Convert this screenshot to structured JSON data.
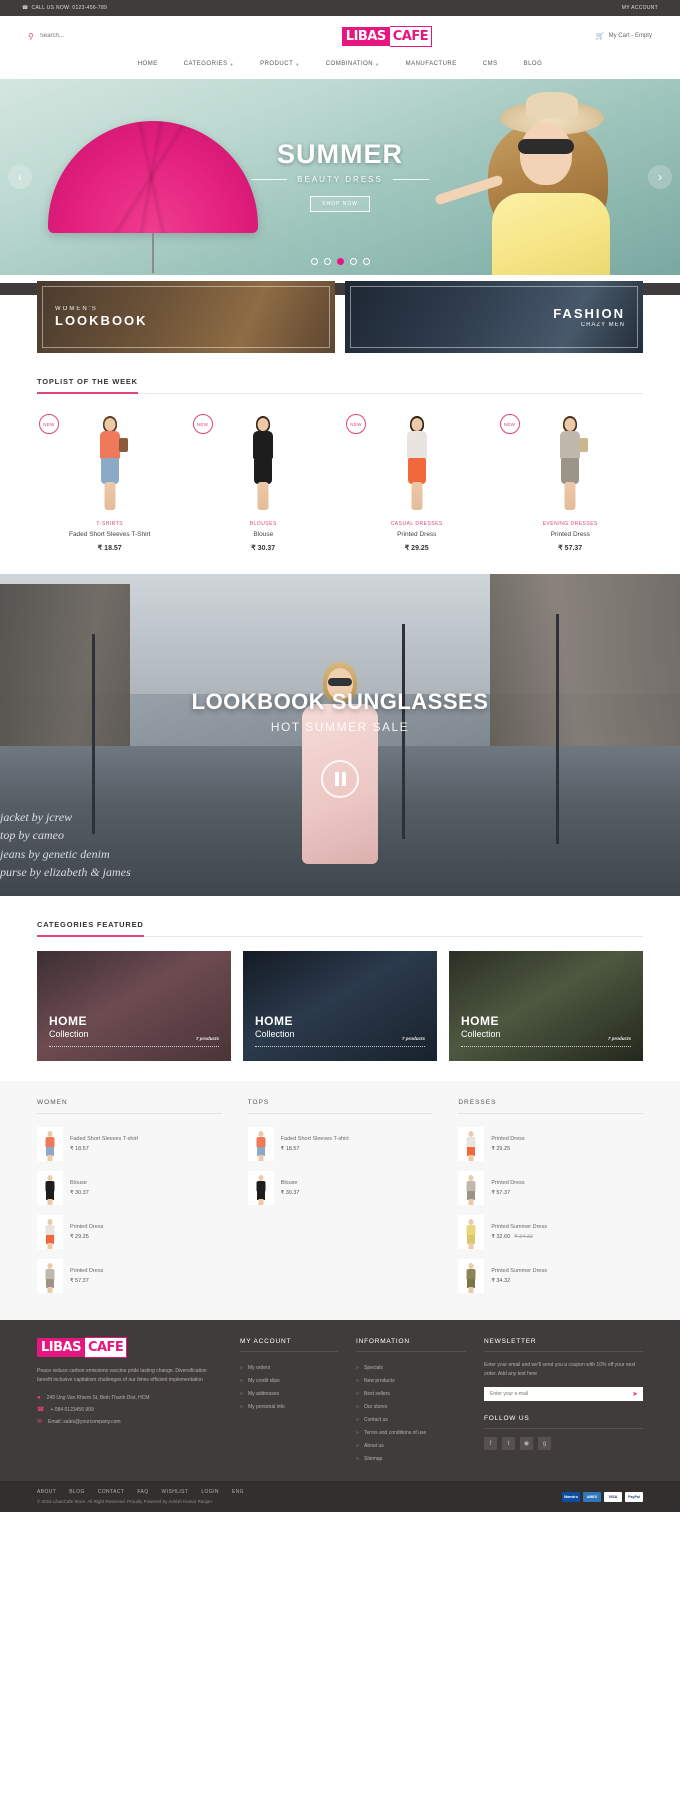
{
  "topbar": {
    "phone_icon": "phone-icon",
    "phone_label": "CALL US NOW: 0123-456-789",
    "account_label": "MY ACCOUNT"
  },
  "header": {
    "search_icon": "search-icon",
    "search_placeholder": "Search...",
    "search_value": "",
    "logo_left": "LIBAS",
    "logo_right": "CAFE",
    "cart_icon": "cart-icon",
    "cart_label": "My Cart - Empty"
  },
  "nav": {
    "items": [
      {
        "label": "HOME",
        "has_caret": false
      },
      {
        "label": "CATEGORIES",
        "has_caret": true
      },
      {
        "label": "PRODUCT",
        "has_caret": true
      },
      {
        "label": "COMBINATION",
        "has_caret": true
      },
      {
        "label": "MANUFACTURE",
        "has_caret": false
      },
      {
        "label": "CMS",
        "has_caret": false
      },
      {
        "label": "BLOG",
        "has_caret": false
      }
    ]
  },
  "hero": {
    "title": "SUMMER",
    "subtitle": "BEAUTY DRESS",
    "button_label": "SHOP NOW",
    "prev_icon": "chevron-left-icon",
    "next_icon": "chevron-right-icon",
    "dots": 5,
    "active_dot": 3
  },
  "banners": [
    {
      "sub": "WOMEN'S",
      "title": "LOOKBOOK",
      "sub2": ""
    },
    {
      "sub": "",
      "title": "FASHION",
      "sub2": "CRAZY MEN"
    }
  ],
  "toplist": {
    "title": "TOPLIST OF THE WEEK",
    "badge_label": "NEW",
    "products": [
      {
        "category": "T-SHIRTS",
        "name": "Faded Short Sleeves T-Shirt",
        "price": "₹ 18.57",
        "hair": "#5b3a22",
        "top": "#f0795a",
        "bottom": "#8ca9c8",
        "legs": "#eec9a8"
      },
      {
        "category": "BLOUSES",
        "name": "Blouse",
        "price": "₹ 30.37",
        "hair": "#3a2616",
        "top": "#1d1d1d",
        "bottom": "#1d1d1d",
        "legs": "#eec9a8"
      },
      {
        "category": "CASUAL DRESSES",
        "name": "Printed Dress",
        "price": "₹ 29.25",
        "hair": "#2e1f12",
        "top": "#e8e4df",
        "bottom": "#f2683c",
        "legs": "#eec9a8"
      },
      {
        "category": "EVENING DRESSES",
        "name": "Printed Dress",
        "price": "₹ 57.37",
        "hair": "#4a2f1a",
        "top": "#bfb9ad",
        "bottom": "#9c9487",
        "legs": "#eec9a8"
      }
    ]
  },
  "video": {
    "title": "LOOKBOOK SUNGLASSES",
    "subtitle": "HOT SUMMER SALE",
    "play_icon": "pause-icon",
    "caption": "jacket by jcrew\ntop by cameo\njeans by genetic denim\npurse by elizabeth & james"
  },
  "categories_featured": {
    "title": "CATEGORIES FEATURED",
    "items": [
      {
        "title": "HOME",
        "subtitle": "Collection",
        "count": "7 products"
      },
      {
        "title": "HOME",
        "subtitle": "Collection",
        "count": "7 products"
      },
      {
        "title": "HOME",
        "subtitle": "Collection",
        "count": "7 products"
      }
    ]
  },
  "lists": [
    {
      "title": "WOMEN",
      "items": [
        {
          "name": "Faded Short Sleeves T-shirt",
          "price": "₹ 18.57",
          "old_price": "",
          "hair": "#5b3a22",
          "top": "#f0795a",
          "bottom": "#8ca9c8"
        },
        {
          "name": "Blouse",
          "price": "₹ 30.37",
          "old_price": "",
          "hair": "#3a2616",
          "top": "#1d1d1d",
          "bottom": "#1d1d1d"
        },
        {
          "name": "Printed Dress",
          "price": "₹ 29.25",
          "old_price": "",
          "hair": "#2e1f12",
          "top": "#e8e4df",
          "bottom": "#f2683c"
        },
        {
          "name": "Printed Dress",
          "price": "₹ 57.37",
          "old_price": "",
          "hair": "#4a2f1a",
          "top": "#bfb9ad",
          "bottom": "#9c9487"
        }
      ]
    },
    {
      "title": "TOPS",
      "items": [
        {
          "name": "Faded Short Sleeves T-shirt",
          "price": "₹ 18.57",
          "old_price": "",
          "hair": "#5b3a22",
          "top": "#f0795a",
          "bottom": "#8ca9c8"
        },
        {
          "name": "Blouse",
          "price": "₹ 30.37",
          "old_price": "",
          "hair": "#3a2616",
          "top": "#1d1d1d",
          "bottom": "#1d1d1d"
        }
      ]
    },
    {
      "title": "DRESSES",
      "items": [
        {
          "name": "Printed Dress",
          "price": "₹ 29.25",
          "old_price": "",
          "hair": "#2e1f12",
          "top": "#e8e4df",
          "bottom": "#f2683c"
        },
        {
          "name": "Printed Dress",
          "price": "₹ 57.37",
          "old_price": "",
          "hair": "#4a2f1a",
          "top": "#bfb9ad",
          "bottom": "#9c9487"
        },
        {
          "name": "Printed Summer Dress",
          "price": "₹ 32.60",
          "old_price": "₹ 34.32",
          "hair": "#6b4a28",
          "top": "#e8d77f",
          "bottom": "#d8c76d"
        },
        {
          "name": "Printed Summer Dress",
          "price": "₹ 34.32",
          "old_price": "",
          "hair": "#4f3a20",
          "top": "#8a8457",
          "bottom": "#7a7449"
        }
      ]
    }
  ],
  "footer": {
    "logo_left": "LIBAS",
    "logo_right": "CAFE",
    "description": "Peace reduce carbon emissions vaccine pride lasting change. Diversification benefit inclusive capitalism challenges of our times efficient implementation",
    "contacts": [
      {
        "icon": "location-pin-icon",
        "text": "249 Ung Van Khiem St, Binh Thanh Dist, HCM"
      },
      {
        "icon": "phone-icon",
        "text": "+ 084 0123456 999"
      },
      {
        "icon": "mail-icon",
        "text": "Email: sales@yourcompany.com"
      }
    ],
    "my_account": {
      "title": "MY ACCOUNT",
      "links": [
        "My orders",
        "My credit slips",
        "My addresses",
        "My personal info"
      ]
    },
    "information": {
      "title": "INFORMATION",
      "links": [
        "Specials",
        "New products",
        "Best sellers",
        "Our stores",
        "Contact us",
        "Terms and conditions of use",
        "About us",
        "Sitemap"
      ]
    },
    "newsletter": {
      "title": "NEWSLETTER",
      "text": "Enter your email and we'll send you a coupon with 10% off your next order. Add any text here",
      "placeholder": "Enter your e-mail",
      "value": "",
      "submit_icon": "send-icon"
    },
    "follow": {
      "title": "FOLLOW US",
      "socials": [
        "facebook-icon",
        "twitter-icon",
        "rss-icon",
        "google-plus-icon"
      ]
    }
  },
  "bottombar": {
    "links": [
      "ABOUT",
      "BLOG",
      "CONTACT",
      "FAQ",
      "WISHLIST",
      "LOGIN",
      "ENG"
    ],
    "copyright": "© 2016 LibasCafe Store. All Right Reserved. Proudly Powered by Ashish Kumar Ranjan",
    "payments": [
      {
        "label": "Maestro",
        "bg": "#0b4ea2",
        "fg": "#ffffff"
      },
      {
        "label": "AMEX",
        "bg": "#2e77bb",
        "fg": "#ffffff"
      },
      {
        "label": "VISA",
        "bg": "#ffffff",
        "fg": "#1a1f71"
      },
      {
        "label": "PayPal",
        "bg": "#ffffff",
        "fg": "#253b80"
      }
    ]
  }
}
